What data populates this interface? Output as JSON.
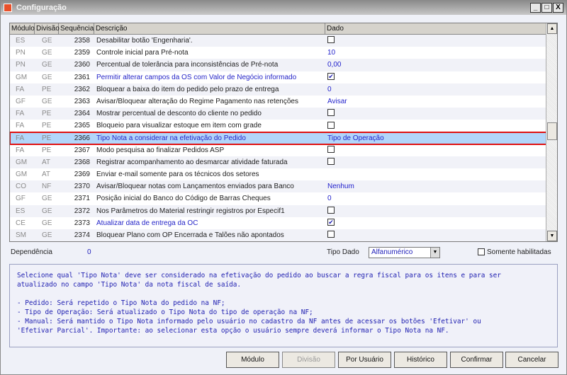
{
  "window": {
    "title": "Configuração",
    "minimize": "_",
    "maximize": "□",
    "close": "X"
  },
  "columns": [
    "Módulo",
    "Divisão",
    "Sequência",
    "Descrição",
    "Dado"
  ],
  "rows": [
    {
      "modulo": "ES",
      "divisao": "GE",
      "seq": "2358",
      "desc": "Desabilitar botão 'Engenharia'.",
      "dado": "",
      "type": "checkbox",
      "checked": false,
      "blue": false
    },
    {
      "modulo": "PN",
      "divisao": "GE",
      "seq": "2359",
      "desc": "Controle inicial para Pré-nota",
      "dado": "10",
      "type": "text",
      "blue": false
    },
    {
      "modulo": "PN",
      "divisao": "GE",
      "seq": "2360",
      "desc": "Percentual de tolerância para inconsistências de Pré-nota",
      "dado": "0,00",
      "type": "text",
      "blue": false
    },
    {
      "modulo": "GM",
      "divisao": "GE",
      "seq": "2361",
      "desc": "Permitir alterar campos da OS com Valor de Negócio informado",
      "dado": "",
      "type": "checkbox",
      "checked": true,
      "blue": true
    },
    {
      "modulo": "FA",
      "divisao": "PE",
      "seq": "2362",
      "desc": "Bloquear a baixa do item do pedido pelo prazo de entrega",
      "dado": "0",
      "type": "text",
      "blue": false
    },
    {
      "modulo": "GF",
      "divisao": "GE",
      "seq": "2363",
      "desc": "Avisar/Bloquear alteração do Regime Pagamento nas retenções",
      "dado": "Avisar",
      "type": "text",
      "blue": false
    },
    {
      "modulo": "FA",
      "divisao": "PE",
      "seq": "2364",
      "desc": "Mostrar percentual de desconto do cliente no pedido",
      "dado": "",
      "type": "checkbox",
      "checked": false,
      "blue": false
    },
    {
      "modulo": "FA",
      "divisao": "PE",
      "seq": "2365",
      "desc": "Bloqueio para visualizar estoque em item com grade",
      "dado": "",
      "type": "checkbox",
      "checked": false,
      "blue": false
    },
    {
      "modulo": "FA",
      "divisao": "PE",
      "seq": "2366",
      "desc": "Tipo Nota a considerar na efetivação do Pedido",
      "dado": "Tipo de Operação",
      "type": "text",
      "blue": true,
      "selected": true
    },
    {
      "modulo": "FA",
      "divisao": "PE",
      "seq": "2367",
      "desc": "Modo pesquisa ao finalizar Pedidos ASP",
      "dado": "",
      "type": "checkbox",
      "checked": false,
      "blue": false
    },
    {
      "modulo": "GM",
      "divisao": "AT",
      "seq": "2368",
      "desc": "Registrar acompanhamento ao desmarcar atividade faturada",
      "dado": "",
      "type": "checkbox",
      "checked": false,
      "blue": false
    },
    {
      "modulo": "GM",
      "divisao": "AT",
      "seq": "2369",
      "desc": "Enviar e-mail somente para os técnicos dos setores",
      "dado": "",
      "type": "text",
      "blue": false
    },
    {
      "modulo": "CO",
      "divisao": "NF",
      "seq": "2370",
      "desc": "Avisar/Bloquear notas com Lançamentos enviados para Banco",
      "dado": "Nenhum",
      "type": "text",
      "blue": false
    },
    {
      "modulo": "GF",
      "divisao": "GE",
      "seq": "2371",
      "desc": "Posição inicial do Banco do Código de Barras Cheques",
      "dado": "0",
      "type": "text",
      "blue": false
    },
    {
      "modulo": "ES",
      "divisao": "GE",
      "seq": "2372",
      "desc": "Nos Parâmetros do Material restringir registros por Especif1",
      "dado": "",
      "type": "checkbox",
      "checked": false,
      "blue": false
    },
    {
      "modulo": "CE",
      "divisao": "GE",
      "seq": "2373",
      "desc": "Atualizar data de entrega da OC",
      "dado": "",
      "type": "checkbox",
      "checked": true,
      "blue": true
    },
    {
      "modulo": "SM",
      "divisao": "GE",
      "seq": "2374",
      "desc": "Bloquear Plano com OP Encerrada e Talões não apontados",
      "dado": "",
      "type": "checkbox",
      "checked": false,
      "blue": false
    }
  ],
  "footer": {
    "dependencia_label": "Dependência",
    "dependencia_value": "0",
    "tipo_dado_label": "Tipo Dado",
    "tipo_dado_value": "Alfanumérico",
    "somente_label": "Somente habilitadas"
  },
  "description": "Selecione qual 'Tipo Nota' deve ser considerado na efetivação do pedido ao buscar a regra fiscal para os itens e para ser\natualizado no campo 'Tipo Nota' da nota fiscal de saída.\n\n- Pedido: Será repetido o Tipo Nota do pedido na NF;\n- Tipo de Operação: Será atualizado o Tipo Nota do tipo de operação na NF;\n- Manual: Será mantido o Tipo Nota informado pelo usuário no cadastro da NF antes de acessar os botões 'Efetivar' ou\n'Efetivar Parcial'. Importante: ao selecionar esta opção o usuário sempre deverá informar o Tipo Nota na NF.",
  "buttons": {
    "modulo": "Módulo",
    "divisao": "Divisão",
    "por_usuario": "Por Usuário",
    "historico": "Histórico",
    "confirmar": "Confirmar",
    "cancelar": "Cancelar"
  }
}
